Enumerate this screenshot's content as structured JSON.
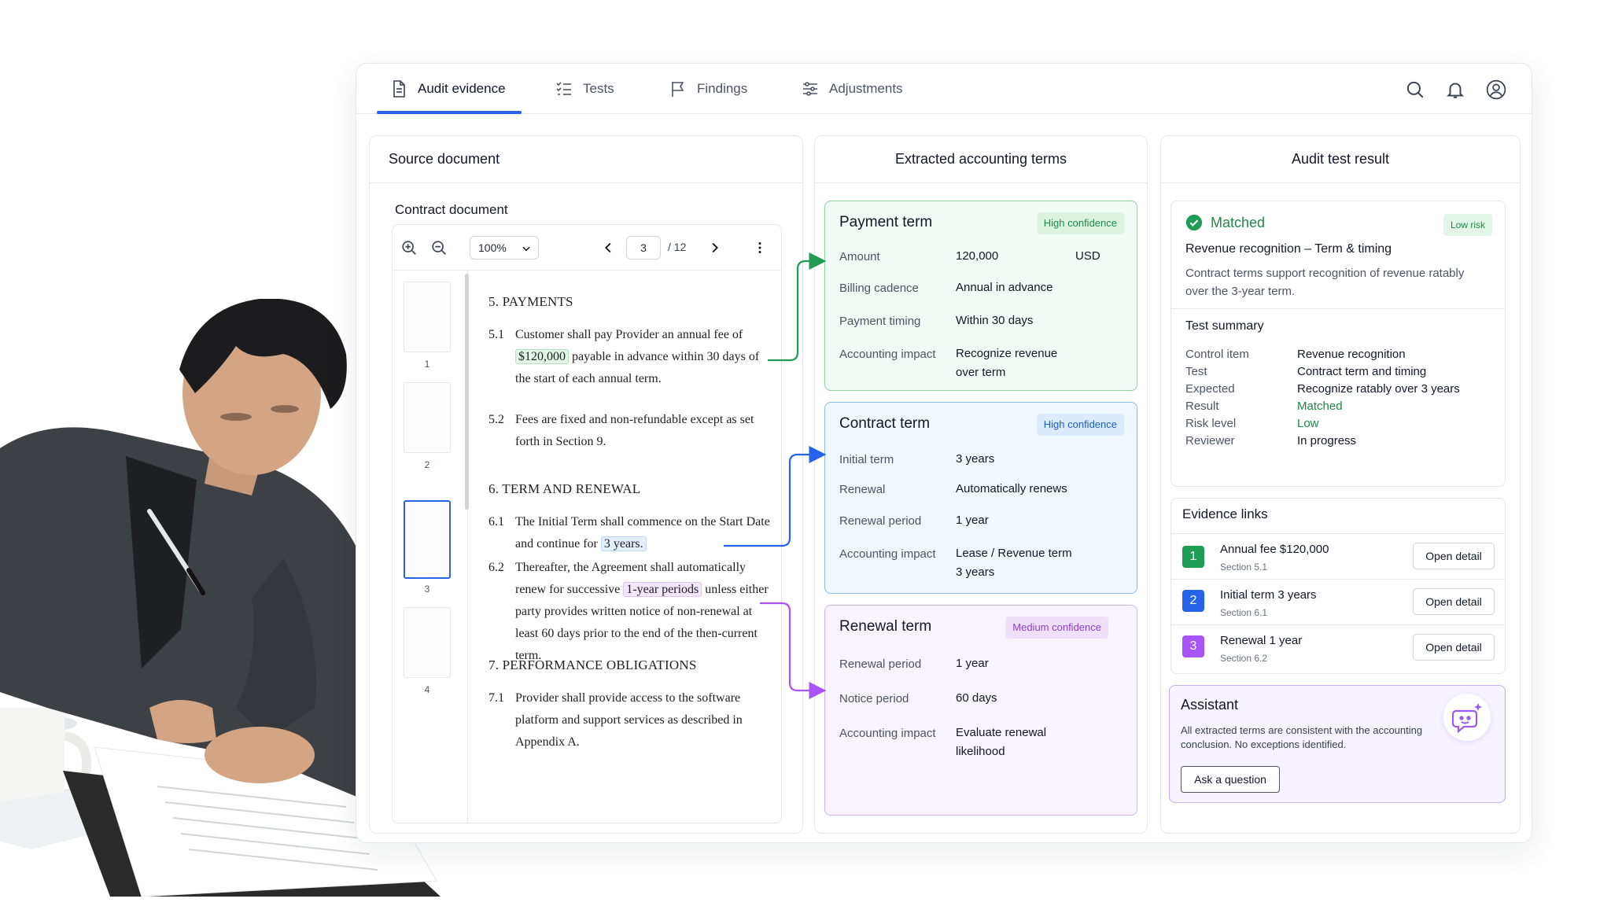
{
  "nav": {
    "tabs": [
      {
        "label": "Audit evidence",
        "icon": "document-icon"
      },
      {
        "label": "Tests",
        "icon": "checklist-icon"
      },
      {
        "label": "Findings",
        "icon": "flag-icon"
      },
      {
        "label": "Adjustments",
        "icon": "sliders-icon"
      }
    ],
    "icons": [
      "search-icon",
      "bell-icon",
      "user-icon"
    ]
  },
  "source": {
    "header": "Source document",
    "doc_label": "Contract document",
    "zoom": "100%",
    "page": "3",
    "page_total": "/ 12",
    "thumbs": [
      "1",
      "2",
      "3",
      "4"
    ],
    "active_page": 3,
    "sections": {
      "s5": "5. PAYMENTS",
      "p51_num": "5.1",
      "p51_a": "Customer shall pay Provider an annual fee of",
      "p51_hl": "$120,000",
      "p51_b": "payable in advance within 30 days of the start of each annual term.",
      "p52_num": "5.2",
      "p52": "Fees are fixed and non-refundable except as set forth in Section 9.",
      "s6": "6. TERM AND RENEWAL",
      "p61_num": "6.1",
      "p61_a": "The Initial Term shall commence on the Start Date and continue for",
      "p61_hl": "3 years.",
      "p62_num": "6.2",
      "p62_a": "Thereafter, the Agreement shall automatically renew for successive",
      "p62_hl": "1-year periods",
      "p62_b": "unless either party provides written notice of non-renewal at least 60 days prior to the end of the then-current term.",
      "s7": "7. PERFORMANCE OBLIGATIONS",
      "p71_num": "7.1",
      "p71": "Provider shall provide access to the software platform and support services as described in Appendix A."
    }
  },
  "terms": {
    "header": "Extracted accounting terms",
    "payment": {
      "title": "Payment term",
      "badge": "High confidence",
      "amount_label": "Amount",
      "amount_value": "120,000",
      "amount_currency": "USD",
      "cadence_label": "Billing cadence",
      "cadence_value": "Annual in advance",
      "timing_label": "Payment timing",
      "timing_value": "Within 30 days",
      "impact_label": "Accounting impact",
      "impact_value_1": "Recognize revenue",
      "impact_value_2": "over term"
    },
    "contract": {
      "title": "Contract term",
      "badge": "High confidence",
      "initial_label": "Initial term",
      "initial_value": "3 years",
      "renewal_label": "Renewal",
      "renewal_value": "Automatically renews",
      "period_label": "Renewal period",
      "period_value": "1 year",
      "impact_label": "Accounting impact",
      "impact_value_1": "Lease / Revenue term",
      "impact_value_2": "3 years"
    },
    "renewal": {
      "title": "Renewal term",
      "badge": "Medium confidence",
      "period_label": "Renewal period",
      "period_value": "1 year",
      "notice_label": "Notice period",
      "notice_value": "60 days",
      "impact_label": "Accounting impact",
      "impact_value_1": "Evaluate renewal",
      "impact_value_2": "likelihood"
    }
  },
  "result": {
    "header": "Audit test result",
    "status": "Matched",
    "risk_badge": "Low risk",
    "title": "Revenue recognition – Term & timing",
    "description": "Contract terms support recognition of revenue ratably over the 3-year term.",
    "summary_title": "Test summary",
    "summary": [
      {
        "label": "Control item",
        "value": "Revenue recognition"
      },
      {
        "label": "Test",
        "value": "Contract term and timing"
      },
      {
        "label": "Expected",
        "value": "Recognize ratably over 3 years"
      },
      {
        "label": "Result",
        "value": "Matched"
      },
      {
        "label": "Risk level",
        "value": "Low"
      },
      {
        "label": "Reviewer",
        "value": "In progress"
      }
    ],
    "evidence_title": "Evidence links",
    "evidence": [
      {
        "num": "1",
        "main": "Annual fee $120,000",
        "sub": "Section 5.1",
        "button": "Open detail",
        "color": "#1f9d55"
      },
      {
        "num": "2",
        "main": "Initial term 3 years",
        "sub": "Section 6.1",
        "button": "Open detail",
        "color": "#2563eb"
      },
      {
        "num": "3",
        "main": "Renewal 1 year",
        "sub": "Section 6.2",
        "button": "Open detail",
        "color": "#a855f7"
      }
    ],
    "assistant": {
      "title": "Assistant",
      "text": "All extracted terms are consistent with the accounting conclusion. No exceptions identified.",
      "button": "Ask a question"
    }
  },
  "colors": {
    "accent": "#2563eb",
    "green": "#1f8a43",
    "blue": "#1d5fbd",
    "purple": "#a855f7"
  }
}
